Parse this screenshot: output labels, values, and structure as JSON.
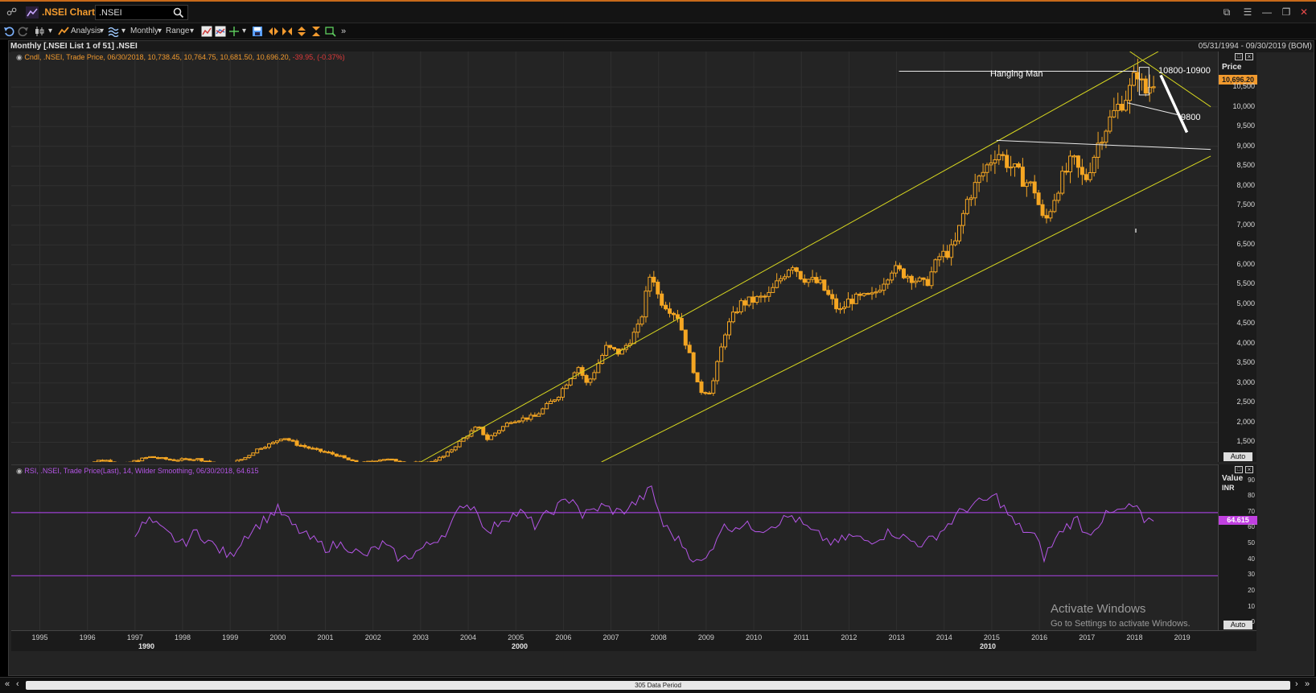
{
  "window": {
    "title": ".NSEI Chart",
    "ric_value": ".NSEI"
  },
  "toolbar": {
    "analysis_label": "Analysis",
    "interval_label": "Monthly",
    "range_label": "Range"
  },
  "chart": {
    "header_left": "Monthly [.NSEI List 1 of 51] .NSEI",
    "header_right": "05/31/1994 - 09/30/2019 (BOM)",
    "price_legend_main": "Cndl, .NSEI, Trade Price, 06/30/2018, 10,738.45, 10,764.75, 10,681.50, 10,696.20,",
    "price_legend_change": "-39.95, (-0.37%)",
    "rsi_legend": "RSI, .NSEI, Trade Price(Last),  14, Wilder Smoothing, 06/30/2018, 64.615",
    "price_axis_title": "Price",
    "last_price_badge": "10,696.20",
    "rsi_axis_title": "Value",
    "rsi_axis_unit": "INR",
    "rsi_last_badge": "64.615",
    "auto_label": "Auto",
    "data_period_label": "305 Data Period"
  },
  "annotations": {
    "hanging_man": "Hanging Man",
    "target_range": "10800-10900",
    "target_low": "9800"
  },
  "watermark": {
    "line1": "Activate Windows",
    "line2": "Go to Settings to activate Windows."
  },
  "colors": {
    "accent_orange": "#f29a2e",
    "candle": "#f5a623",
    "trendline": "#d8d820",
    "rsi_line": "#b455e6",
    "rsi_band": "#9b3fd0",
    "badge_price": "#f29a2e",
    "badge_rsi": "#c040e0",
    "change_negative": "#e03a3a"
  },
  "chart_data": [
    {
      "type": "candlestick",
      "series": [
        {
          "name": ".NSEI"
        }
      ],
      "x_range": [
        1994.4,
        2019.75
      ],
      "ylim": [
        1000,
        11400
      ],
      "yticks": [
        1500,
        2000,
        2500,
        3000,
        3500,
        4000,
        4500,
        5000,
        5500,
        6000,
        6500,
        7000,
        7500,
        8000,
        8500,
        9000,
        9500,
        10000,
        10500
      ],
      "ytick_labels": [
        "1,500",
        "2,000",
        "2,500",
        "3,000",
        "3,500",
        "4,000",
        "4,500",
        "5,000",
        "5,500",
        "6,000",
        "6,500",
        "7,000",
        "7,500",
        "8,000",
        "8,500",
        "9,000",
        "9,500",
        "10,000",
        "10,500"
      ],
      "xticks": [
        1995,
        1996,
        1997,
        1998,
        1999,
        2000,
        2001,
        2002,
        2003,
        2004,
        2005,
        2006,
        2007,
        2008,
        2009,
        2010,
        2011,
        2012,
        2013,
        2014,
        2015,
        2016,
        2017,
        2018,
        2019
      ],
      "decade_labels": [
        {
          "x": 1990,
          "label": "1990"
        },
        {
          "x": 2000,
          "label": "2000"
        },
        {
          "x": 2010,
          "label": "2010"
        }
      ],
      "last_value": 10696.2,
      "close_path": [
        [
          1995.9,
          920
        ],
        [
          1996.3,
          1060
        ],
        [
          1996.8,
          960
        ],
        [
          1997.3,
          1130
        ],
        [
          1997.8,
          1050
        ],
        [
          1998.3,
          1080
        ],
        [
          1998.9,
          900
        ],
        [
          1999.3,
          1100
        ],
        [
          1999.6,
          1350
        ],
        [
          1999.9,
          1480
        ],
        [
          2000.1,
          1640
        ],
        [
          2000.4,
          1450
        ],
        [
          2000.8,
          1300
        ],
        [
          2001.2,
          1190
        ],
        [
          2001.7,
          950
        ],
        [
          2002.2,
          1080
        ],
        [
          2002.7,
          1000
        ],
        [
          2003.1,
          960
        ],
        [
          2003.5,
          1150
        ],
        [
          2003.9,
          1600
        ],
        [
          2004.2,
          1900
        ],
        [
          2004.4,
          1580
        ],
        [
          2004.9,
          2050
        ],
        [
          2005.4,
          2150
        ],
        [
          2005.9,
          2700
        ],
        [
          2006.3,
          3450
        ],
        [
          2006.5,
          2950
        ],
        [
          2006.9,
          3900
        ],
        [
          2007.2,
          3750
        ],
        [
          2007.6,
          4450
        ],
        [
          2007.85,
          5900
        ],
        [
          2008.0,
          5150
        ],
        [
          2008.4,
          4700
        ],
        [
          2008.7,
          3500
        ],
        [
          2008.85,
          2800
        ],
        [
          2009.1,
          2800
        ],
        [
          2009.4,
          4300
        ],
        [
          2009.7,
          5000
        ],
        [
          2010.3,
          5200
        ],
        [
          2010.8,
          6050
        ],
        [
          2011.0,
          5700
        ],
        [
          2011.4,
          5500
        ],
        [
          2011.8,
          4800
        ],
        [
          2012.0,
          5100
        ],
        [
          2012.5,
          5200
        ],
        [
          2012.9,
          5900
        ],
        [
          2013.3,
          5700
        ],
        [
          2013.6,
          5470
        ],
        [
          2013.9,
          6200
        ],
        [
          2014.2,
          6400
        ],
        [
          2014.5,
          7700
        ],
        [
          2014.9,
          8500
        ],
        [
          2015.1,
          8900
        ],
        [
          2015.5,
          8350
        ],
        [
          2015.9,
          7900
        ],
        [
          2016.1,
          7000
        ],
        [
          2016.4,
          8000
        ],
        [
          2016.7,
          8650
        ],
        [
          2016.95,
          8100
        ],
        [
          2017.3,
          9300
        ],
        [
          2017.7,
          10100
        ],
        [
          2017.95,
          10500
        ],
        [
          2018.05,
          11000
        ],
        [
          2018.2,
          10300
        ],
        [
          2018.4,
          10700
        ]
      ]
    },
    {
      "type": "line",
      "series": [
        {
          "name": "RSI"
        }
      ],
      "x_range": [
        1994.4,
        2019.75
      ],
      "ylim": [
        -5,
        100
      ],
      "yticks": [
        0,
        10,
        20,
        30,
        40,
        50,
        60,
        70,
        80,
        90
      ],
      "bands": [
        30,
        70
      ],
      "last_value": 64.615,
      "values": [
        [
          1997.0,
          58
        ],
        [
          1997.3,
          65
        ],
        [
          1997.6,
          58
        ],
        [
          1998.0,
          50
        ],
        [
          1998.3,
          58
        ],
        [
          1998.7,
          48
        ],
        [
          1999.0,
          42
        ],
        [
          1999.3,
          55
        ],
        [
          1999.7,
          65
        ],
        [
          2000.0,
          72
        ],
        [
          2000.3,
          62
        ],
        [
          2000.6,
          55
        ],
        [
          2001.0,
          48
        ],
        [
          2001.4,
          50
        ],
        [
          2001.8,
          42
        ],
        [
          2002.2,
          50
        ],
        [
          2002.6,
          40
        ],
        [
          2002.9,
          45
        ],
        [
          2003.2,
          50
        ],
        [
          2003.6,
          60
        ],
        [
          2003.9,
          76
        ],
        [
          2004.2,
          72
        ],
        [
          2004.4,
          56
        ],
        [
          2004.7,
          66
        ],
        [
          2005.1,
          70
        ],
        [
          2005.4,
          62
        ],
        [
          2005.8,
          72
        ],
        [
          2006.2,
          80
        ],
        [
          2006.4,
          68
        ],
        [
          2006.8,
          74
        ],
        [
          2007.2,
          70
        ],
        [
          2007.6,
          78
        ],
        [
          2007.85,
          85
        ],
        [
          2008.1,
          62
        ],
        [
          2008.5,
          50
        ],
        [
          2008.8,
          38
        ],
        [
          2009.0,
          40
        ],
        [
          2009.3,
          60
        ],
        [
          2009.7,
          62
        ],
        [
          2010.2,
          60
        ],
        [
          2010.8,
          68
        ],
        [
          2011.2,
          58
        ],
        [
          2011.7,
          50
        ],
        [
          2012.0,
          55
        ],
        [
          2012.4,
          52
        ],
        [
          2012.9,
          58
        ],
        [
          2013.3,
          52
        ],
        [
          2013.6,
          50
        ],
        [
          2014.0,
          60
        ],
        [
          2014.4,
          72
        ],
        [
          2014.9,
          78
        ],
        [
          2015.1,
          80
        ],
        [
          2015.5,
          62
        ],
        [
          2015.9,
          55
        ],
        [
          2016.1,
          42
        ],
        [
          2016.5,
          60
        ],
        [
          2016.8,
          66
        ],
        [
          2017.0,
          56
        ],
        [
          2017.4,
          68
        ],
        [
          2017.8,
          72
        ],
        [
          2018.05,
          74
        ],
        [
          2018.2,
          62
        ],
        [
          2018.4,
          64.615
        ]
      ]
    }
  ]
}
